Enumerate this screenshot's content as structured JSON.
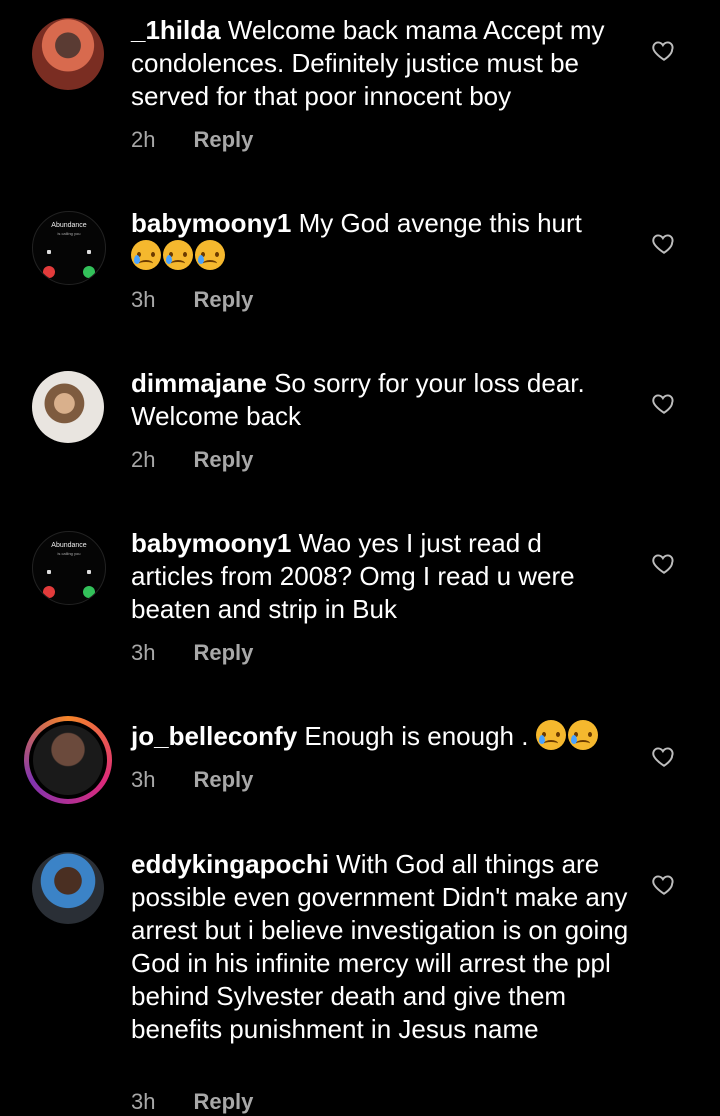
{
  "comments": [
    {
      "username": "_1hilda",
      "text": "Welcome back mama Accept my condolences. Definitely justice must be served for that poor innocent boy",
      "time": "2h",
      "reply": "Reply"
    },
    {
      "username": "babymoony1",
      "text": "My God avenge this hurt",
      "time": "3h",
      "reply": "Reply",
      "avatar_title": "Abundance",
      "avatar_sub": "is calling you"
    },
    {
      "username": "dimmajane",
      "text": "So sorry for your loss dear. Welcome back",
      "time": "2h",
      "reply": "Reply"
    },
    {
      "username": "babymoony1",
      "text": "Wao yes I just read d articles from 2008? Omg I read u were beaten and strip in Buk",
      "time": "3h",
      "reply": "Reply",
      "avatar_title": "Abundance",
      "avatar_sub": "is calling you"
    },
    {
      "username": "jo_belleconfy",
      "text": "Enough is enough .",
      "time": "3h",
      "reply": "Reply"
    },
    {
      "username": "eddykingapochi",
      "text": "With God all things are possible even government Didn't make any arrest but i believe investigation is on going God in his infinite mercy will arrest the ppl behind Sylvester death and give them benefits punishment in Jesus name",
      "time": "3h",
      "reply": "Reply"
    }
  ],
  "icons": {
    "heart": "heart-outline-icon",
    "emoji": "crying-face-emoji"
  },
  "colors": {
    "background": "#000000",
    "meta": "#a8a8a8",
    "story_ring": "#dd2a7b"
  }
}
